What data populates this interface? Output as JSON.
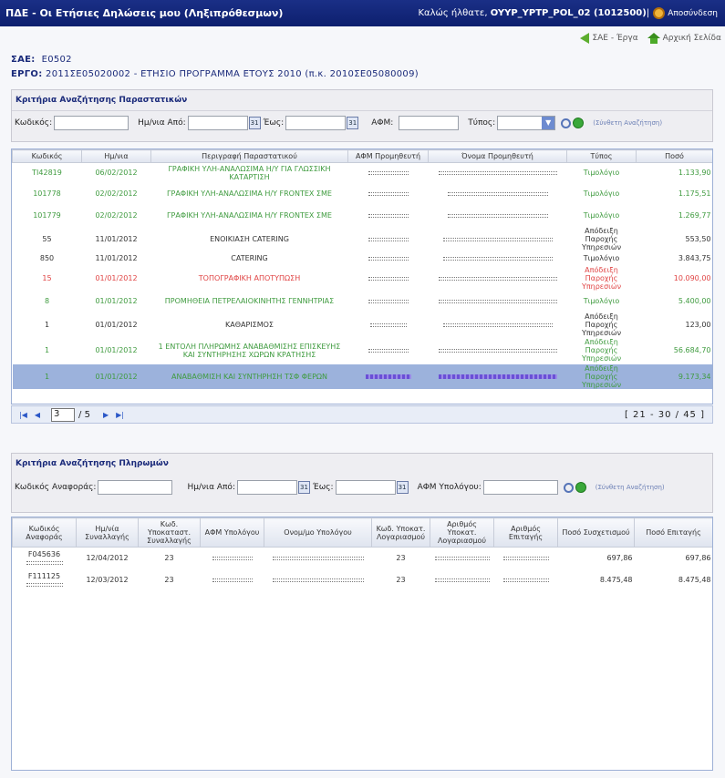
{
  "header": {
    "app_title": "ΠΔΕ - Οι Ετήσιες Δηλώσεις μου (Ληξιπρόθεσμων)",
    "welcome_prefix": "Καλώς ήλθατε,",
    "user": "OYYP_YPTP_POL_02 (1012500)",
    "separator": "|",
    "logout": "Αποσύνδεση"
  },
  "links": {
    "sae_projects": "ΣΑΕ - Έργα",
    "home": "Αρχική Σελίδα"
  },
  "project": {
    "sae_label": "ΣΑΕ:",
    "sae_value": "Ε0502",
    "ergo_label": "ΕΡΓΟ:",
    "ergo_value": "2011ΣΕ05020002 - ΕΤΗΣΙΟ ΠΡΟΓΡΑΜΜΑ ΕΤΟΥΣ 2010 (π.κ. 2010ΣΕ05080009)"
  },
  "doc_search": {
    "title": "Κριτήρια Αναζήτησης Παραστατικών",
    "code_label": "Κωδικός:",
    "date_from_label": "Ημ/νια Από:",
    "date_to_label": "Έως:",
    "afm_label": "ΑΦΜ:",
    "type_label": "Τύπος:",
    "complex_search": "(Σύνθετη Αναζήτηση)",
    "cal_glyph": "31"
  },
  "docs_table": {
    "columns": [
      "Κωδικός",
      "Ημ/νια",
      "Περιγραφή Παραστατικού",
      "ΑΦΜ Προμηθευτή",
      "Όνομα Προμηθευτή",
      "Τύπος",
      "Ποσό"
    ],
    "rows": [
      {
        "code": "TI42819",
        "date": "06/02/2012",
        "desc": "ΓΡΑΦΙΚΗ ΥΛΗ-ΑΝΑΛΩΣΙΜΑ Η/Υ ΓΙΑ ΓΛΩΣΣΙΚΗ ΚΑΤΑΡΤΙΣΗ",
        "type": "Τιμολόγιο",
        "amount": "1.133,90",
        "color": "green"
      },
      {
        "code": "101778",
        "date": "02/02/2012",
        "desc": "ΓΡΑΦΙΚΗ ΥΛΗ-ΑΝΑΛΩΣΙΜΑ Η/Υ FRONTEX ΣΜΕ",
        "type": "Τιμολόγιο",
        "amount": "1.175,51",
        "color": "green"
      },
      {
        "code": "101779",
        "date": "02/02/2012",
        "desc": "ΓΡΑΦΙΚΗ ΥΛΗ-ΑΝΑΛΩΣΙΜΑ Η/Υ FRONTEX ΣΜΕ",
        "type": "Τιμολόγιο",
        "amount": "1.269,77",
        "color": "green"
      },
      {
        "code": "55",
        "date": "11/01/2012",
        "desc": "ΕΝΟΙΚΙΑΣΗ CATERING",
        "type": "Απόδειξη Παροχής Υπηρεσιών",
        "amount": "553,50",
        "color": "dark"
      },
      {
        "code": "850",
        "date": "11/01/2012",
        "desc": "CATERING",
        "type": "Τιμολόγιο",
        "amount": "3.843,75",
        "color": "dark"
      },
      {
        "code": "15",
        "date": "01/01/2012",
        "desc": "ΤΟΠΟΓΡΑΦΙΚΗ ΑΠΟΤΥΠΩΣΗ",
        "type": "Απόδειξη Παροχής Υπηρεσιών",
        "amount": "10.090,00",
        "color": "red"
      },
      {
        "code": "8",
        "date": "01/01/2012",
        "desc": "ΠΡΟΜΗΘΕΙΑ ΠΕΤΡΕΛΑΙΟΚΙΝΗΤΗΣ ΓΕΝΝΗΤΡΙΑΣ",
        "type": "Τιμολόγιο",
        "amount": "5.400,00",
        "color": "green"
      },
      {
        "code": "1",
        "date": "01/01/2012",
        "desc": "ΚΑΘΑΡΙΣΜΟΣ",
        "type": "Απόδειξη Παροχής Υπηρεσιών",
        "amount": "123,00",
        "color": "dark"
      },
      {
        "code": "1",
        "date": "01/01/2012",
        "desc": "1 ΕΝΤΟΛΗ ΠΛΗΡΩΜΗΣ ΑΝΑΒΑΘΜΙΣΗΣ ΕΠΙΣΚΕΥΗΣ ΚΑΙ ΣΥΝΤΗΡΗΣΗΣ ΧΩΡΩΝ ΚΡΑΤΗΣΗΣ",
        "type": "Απόδειξη Παροχής Υπηρεσιών",
        "amount": "56.684,70",
        "color": "green"
      },
      {
        "code": "1",
        "date": "01/01/2012",
        "desc": "ΑΝΑΒΑΘΜΙΣΗ ΚΑΙ ΣΥΝΤΗΡΗΣΗ ΤΣΦ ΦΕΡΩΝ",
        "type": "Απόδειξη Παροχής Υπηρεσιών",
        "amount": "9.173,34",
        "color": "green",
        "selected": true
      }
    ]
  },
  "pager": {
    "page": "3",
    "total": "/ 5",
    "range": "[ 21 - 30 / 45 ]"
  },
  "pay_search": {
    "title": "Κριτήρια Αναζήτησης Πληρωμών",
    "ref_label": "Κωδικός Αναφοράς:",
    "date_from_label": "Ημ/νια Από:",
    "date_to_label": "Έως:",
    "afm_label": "ΑΦΜ Υπολόγου:",
    "complex_search": "(Σύνθετη Αναζήτηση)",
    "cal_glyph": "31"
  },
  "payments_table": {
    "columns": [
      "Κωδικός Αναφοράς",
      "Ημ/νία Συναλλαγής",
      "Κωδ. Υποκαταστ. Συναλλαγής",
      "ΑΦΜ Υπολόγου",
      "Ονομ/μο Υπολόγου",
      "Κωδ. Υποκατ. Λογαριασμού",
      "Αριθμός Υποκατ. Λογαριασμού",
      "Αριθμός Επιταγής",
      "Ποσό Συσχετισμού",
      "Ποσό Επιταγής"
    ],
    "rows": [
      {
        "ref": "F045636",
        "date": "12/04/2012",
        "branch": "23",
        "acc_branch": "23",
        "amount_rel": "697,86",
        "amount_cheque": "697,86"
      },
      {
        "ref": "F111125",
        "date": "12/03/2012",
        "branch": "23",
        "acc_branch": "23",
        "amount_rel": "8.475,48",
        "amount_cheque": "8.475,48"
      }
    ]
  },
  "colors": {
    "header_bg": "#0d1f6e",
    "green": "#3f9b3f",
    "red": "#e04444",
    "selected_row": "#9cb2dc"
  }
}
